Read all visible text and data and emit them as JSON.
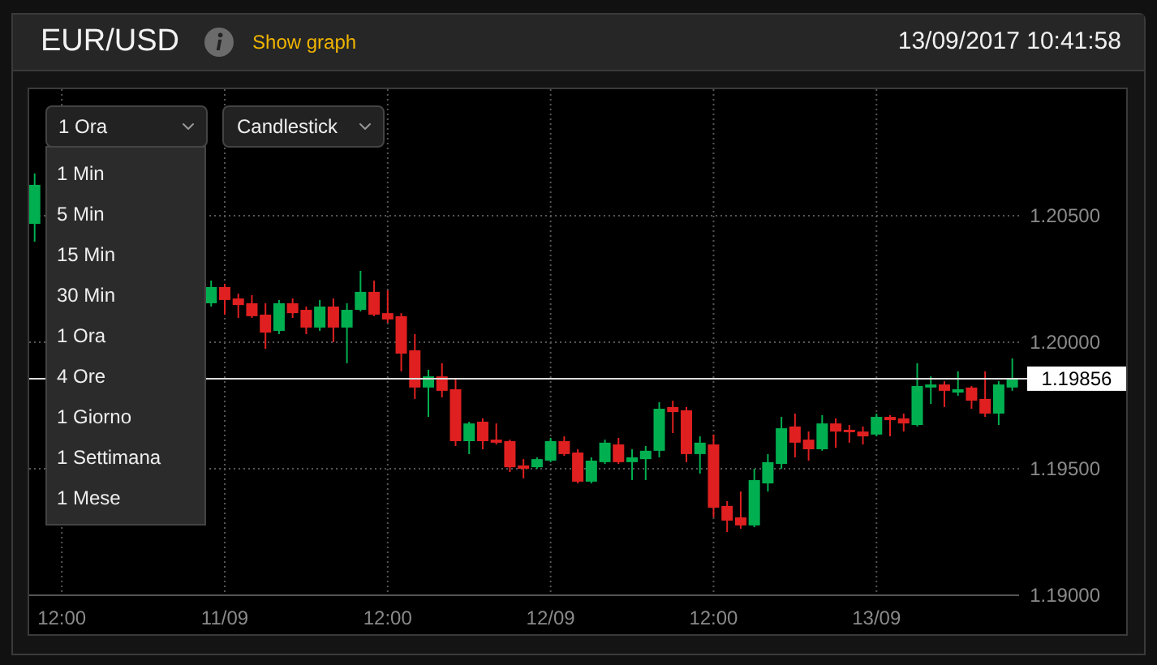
{
  "header": {
    "title": "EUR/USD",
    "link": "Show graph",
    "datetime": "13/09/2017 10:41:58"
  },
  "interval_select": {
    "value": "1 Ora",
    "expanded": true,
    "options": [
      "1 Min",
      "5 Min",
      "15 Min",
      "30 Min",
      "1 Ora",
      "4 Ore",
      "1 Giorno",
      "1 Settimana",
      "1 Mese"
    ]
  },
  "chart_type_select": {
    "value": "Candlestick"
  },
  "chart": {
    "chart_data": {
      "type": "candlestick",
      "categories": [
        null,
        null,
        "12:00",
        null,
        null,
        null,
        null,
        null,
        null,
        null,
        null,
        null,
        null,
        null,
        "11/09",
        null,
        null,
        null,
        null,
        null,
        null,
        null,
        null,
        null,
        null,
        null,
        "12:00",
        null,
        null,
        null,
        null,
        null,
        null,
        null,
        null,
        null,
        null,
        null,
        "12/09",
        null,
        null,
        null,
        null,
        null,
        null,
        null,
        null,
        null,
        null,
        null,
        "12:00",
        null,
        null,
        null,
        null,
        null,
        null,
        null,
        null,
        null,
        null,
        null,
        "13/09",
        null,
        null,
        null,
        null,
        null,
        null,
        null,
        null,
        null,
        null
      ],
      "ohlc": [
        [
          1.20468,
          1.20667,
          1.20397,
          1.20622
        ],
        null,
        null,
        null,
        null,
        null,
        null,
        null,
        null,
        null,
        null,
        null,
        null,
        [
          1.20154,
          1.20244,
          1.20141,
          1.20218
        ],
        [
          1.20218,
          1.20231,
          1.20109,
          1.20167
        ],
        [
          1.20173,
          1.20192,
          1.20096,
          1.20147
        ],
        [
          1.20154,
          1.20186,
          1.20096,
          1.20103
        ],
        [
          1.20109,
          1.20154,
          1.19974,
          1.20038
        ],
        [
          1.20045,
          1.20167,
          1.20032,
          1.20154
        ],
        [
          1.20154,
          1.20173,
          1.20096,
          1.20115
        ],
        [
          1.20128,
          1.20141,
          1.20032,
          1.20058
        ],
        [
          1.20058,
          1.20167,
          1.20045,
          1.20141
        ],
        [
          1.20141,
          1.20173,
          1.2,
          1.20058
        ],
        [
          1.20058,
          1.20154,
          1.19917,
          1.20128
        ],
        [
          1.20128,
          1.20282,
          1.20122,
          1.20199
        ],
        [
          1.20199,
          1.20244,
          1.20103,
          1.20109
        ],
        [
          1.20115,
          1.20205,
          1.20077,
          1.2009
        ],
        [
          1.20103,
          1.20115,
          1.19885,
          1.19955
        ],
        [
          1.19968,
          1.20032,
          1.19776,
          1.19821
        ],
        [
          1.19821,
          1.19891,
          1.19705,
          1.19865
        ],
        [
          1.19865,
          1.19917,
          1.19782,
          1.19808
        ],
        [
          1.19814,
          1.19853,
          1.1959,
          1.19609
        ],
        [
          1.19609,
          1.19686,
          1.19558,
          1.19679
        ],
        [
          1.19686,
          1.19699,
          1.19577,
          1.19609
        ],
        [
          1.19615,
          1.19679,
          1.19596,
          1.19603
        ],
        [
          1.19609,
          1.19615,
          1.19487,
          1.19506
        ],
        [
          1.19513,
          1.19538,
          1.19462,
          1.195
        ],
        [
          1.19506,
          1.19545,
          1.195,
          1.19538
        ],
        [
          1.19532,
          1.19622,
          1.19526,
          1.19609
        ],
        [
          1.19609,
          1.19628,
          1.19551,
          1.19558
        ],
        [
          1.19564,
          1.19577,
          1.19442,
          1.19449
        ],
        [
          1.19449,
          1.19545,
          1.19442,
          1.19532
        ],
        [
          1.19526,
          1.19615,
          1.19519,
          1.19603
        ],
        [
          1.19596,
          1.19622,
          1.19519,
          1.19526
        ],
        [
          1.19526,
          1.19577,
          1.19455,
          1.19545
        ],
        [
          1.19538,
          1.1959,
          1.19455,
          1.19571
        ],
        [
          1.19571,
          1.19763,
          1.19545,
          1.19737
        ],
        [
          1.19744,
          1.19769,
          1.19641,
          1.19724
        ],
        [
          1.19731,
          1.19744,
          1.19526,
          1.19558
        ],
        [
          1.19558,
          1.19628,
          1.19481,
          1.19603
        ],
        [
          1.19596,
          1.19635,
          1.19308,
          1.19346
        ],
        [
          1.19353,
          1.19372,
          1.1925,
          1.19295
        ],
        [
          1.19308,
          1.1941,
          1.19263,
          1.19276
        ],
        [
          1.19276,
          1.195,
          1.19269,
          1.19455
        ],
        [
          1.19442,
          1.19558,
          1.1941,
          1.19526
        ],
        [
          1.19519,
          1.19705,
          1.195,
          1.1966
        ],
        [
          1.19667,
          1.19718,
          1.19545,
          1.19603
        ],
        [
          1.19615,
          1.19647,
          1.19532,
          1.19577
        ],
        [
          1.19577,
          1.19712,
          1.19571,
          1.19679
        ],
        [
          1.19679,
          1.19699,
          1.19583,
          1.19647
        ],
        [
          1.19654,
          1.19673,
          1.19603,
          1.19647
        ],
        [
          1.19647,
          1.19667,
          1.19596,
          1.19628
        ],
        [
          1.19635,
          1.19718,
          1.19628,
          1.19705
        ],
        [
          1.19705,
          1.19712,
          1.19628,
          1.19692
        ],
        [
          1.19699,
          1.19718,
          1.19647,
          1.19679
        ],
        [
          1.19673,
          1.19917,
          1.19667,
          1.19827
        ],
        [
          1.19821,
          1.19865,
          1.19756,
          1.19833
        ],
        [
          1.19833,
          1.19846,
          1.19744,
          1.19808
        ],
        [
          1.19801,
          1.19885,
          1.19788,
          1.19814
        ],
        [
          1.19821,
          1.19827,
          1.19737,
          1.19769
        ],
        [
          1.19776,
          1.19885,
          1.19705,
          1.19718
        ],
        [
          1.19718,
          1.19846,
          1.19673,
          1.19833
        ],
        [
          1.19821,
          1.19936,
          1.19808,
          1.19859
        ]
      ],
      "ylim": [
        1.19,
        1.21
      ],
      "yticks": [
        {
          "value": 1.205,
          "label": "1.20500"
        },
        {
          "value": 1.2,
          "label": "1.20000"
        },
        {
          "value": 1.195,
          "label": "1.19500"
        },
        {
          "value": 1.19,
          "label": "1.19000"
        }
      ],
      "grid": true,
      "ref_lines": [
        {
          "axis": "y",
          "value": 1.19856
        }
      ]
    },
    "current_price": "1.19856"
  }
}
